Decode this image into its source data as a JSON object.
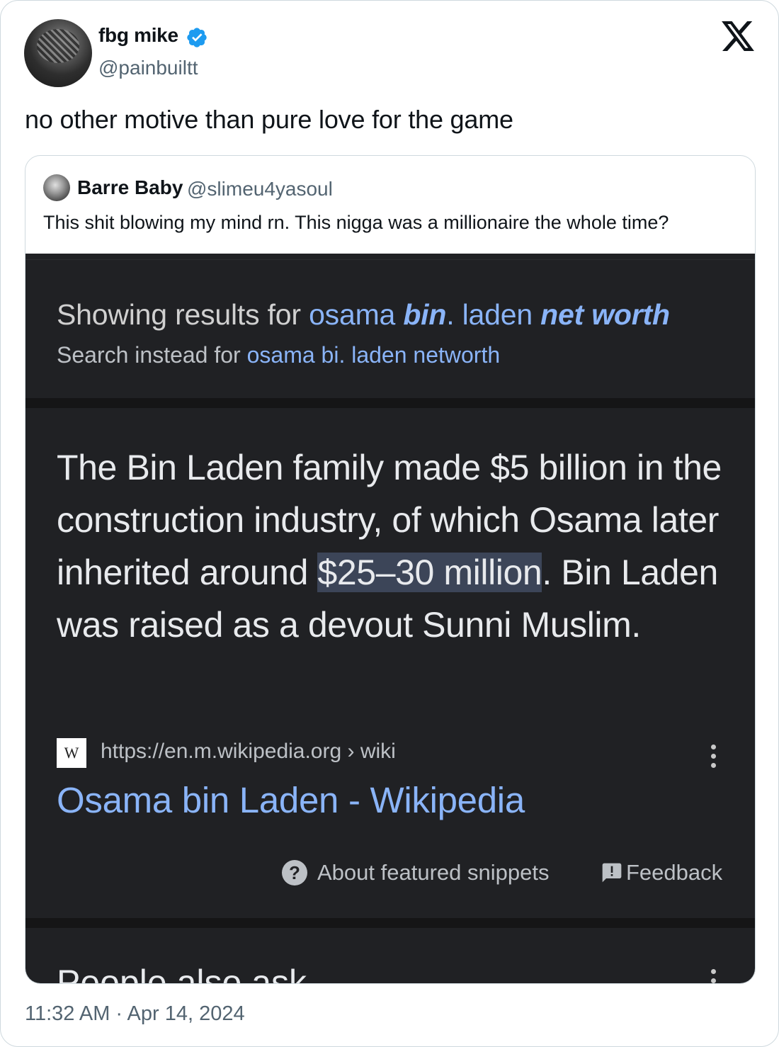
{
  "author": {
    "display_name": "fbg mike",
    "handle": "@painbuiltt",
    "verified": true
  },
  "tweet": {
    "text": "no other motive than pure love for the game",
    "timestamp": "11:32 AM · Apr 14, 2024"
  },
  "quoted": {
    "display_name": "Barre Baby",
    "handle": "@slimeu4yasoul",
    "text": "This shit blowing my mind rn. This nigga was a millionaire the whole time?"
  },
  "screenshot": {
    "showing_prefix": "Showing results for ",
    "showing_q1": "osama ",
    "showing_q2": "bin",
    "showing_q3": ". laden ",
    "showing_q4": "net worth",
    "instead_prefix": "Search instead for ",
    "instead_query": "osama bi. laden networth",
    "snippet_before": "The Bin Laden family made $5 billion in the construction industry, of which Osama later inherited around ",
    "snippet_highlight": "$25–30 million",
    "snippet_after": ". Bin Laden was raised as a devout Sunni Muslim.",
    "favicon_letter": "W",
    "source_url": "https://en.m.wikipedia.org › wiki",
    "result_title": "Osama bin Laden - Wikipedia",
    "about_label": "About featured snippets",
    "feedback_label": "Feedback",
    "people_also_ask": "People also ask"
  },
  "colors": {
    "link": "#8ab4f8",
    "verified": "#1d9bf0",
    "dark_bg": "#202124",
    "highlight": "#3c4558"
  },
  "icons": [
    "verified-badge-icon",
    "x-logo-icon",
    "wikipedia-favicon-icon",
    "more-vert-icon",
    "help-circle-icon",
    "feedback-icon"
  ]
}
